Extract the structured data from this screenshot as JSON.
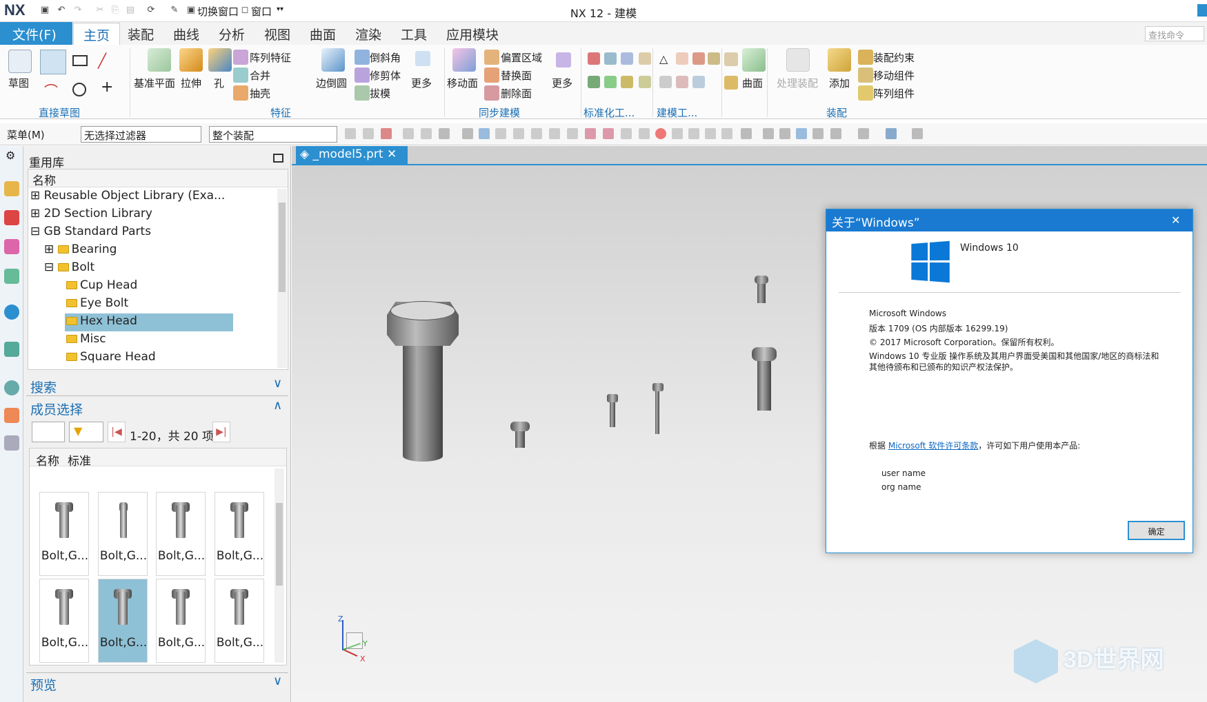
{
  "app": {
    "logo": "NX",
    "title": "NX 12 - 建模"
  },
  "quick_access": {
    "switch_window": "切换窗口",
    "window": "窗口"
  },
  "menu": {
    "file": "文件(F)",
    "tabs": [
      "主页",
      "装配",
      "曲线",
      "分析",
      "视图",
      "曲面",
      "渲染",
      "工具",
      "应用模块"
    ],
    "search_placeholder": "查找命令"
  },
  "ribbon": {
    "sketch": "草图",
    "groups": {
      "direct_sketch": "直接草图",
      "feature": "特征",
      "sync": "同步建模",
      "standard": "标准化工...",
      "modeling": "建模工...",
      "assembly": "装配"
    },
    "feature": {
      "datum_plane": "基准平面",
      "extrude": "拉伸",
      "hole": "孔",
      "pattern": "阵列特征",
      "unite": "合并",
      "shell": "抽壳",
      "edge_blend": "边倒圆",
      "chamfer": "倒斜角",
      "trim_body": "修剪体",
      "draft": "拔模",
      "more": "更多"
    },
    "sync": {
      "move_face": "移动面",
      "offset_region": "偏置区域",
      "replace_face": "替换面",
      "delete_face": "删除面",
      "more": "更多"
    },
    "surface": "曲面",
    "assembly": {
      "process": "处理装配",
      "add": "添加",
      "constraint": "装配约束",
      "move_component": "移动组件",
      "pattern_component": "阵列组件"
    }
  },
  "toolbar2": {
    "menu": "菜单(M)",
    "filter": "无选择过滤器",
    "scope": "整个装配"
  },
  "navigator": {
    "title": "重用库",
    "column_name": "名称",
    "tree": [
      {
        "label": "Reusable Object Library (Exa..."
      },
      {
        "label": "2D Section Library"
      },
      {
        "label": "GB Standard Parts"
      },
      {
        "label": "Bearing"
      },
      {
        "label": "Bolt"
      },
      {
        "label": "Cup Head"
      },
      {
        "label": "Eye Bolt"
      },
      {
        "label": "Hex Head"
      },
      {
        "label": "Misc"
      },
      {
        "label": "Square Head"
      }
    ],
    "search": "搜索",
    "member_select": "成员选择",
    "pager": "1-20，共 20 项",
    "col_name": "名称",
    "col_std": "标准",
    "thumbs": [
      "Bolt,G...",
      "Bolt,G...",
      "Bolt,G...",
      "Bolt,G...",
      "Bolt,G...",
      "Bolt,G...",
      "Bolt,G...",
      "Bolt,G..."
    ],
    "preview": "预览"
  },
  "doc_tab": "_model5.prt",
  "dialog": {
    "title": "关于“Windows”",
    "brand": "Windows 10",
    "product": "Microsoft Windows",
    "version": "版本 1709 (OS 内部版本 16299.19)",
    "copyright": "© 2017 Microsoft Corporation。保留所有权利。",
    "legal1": "Windows 10 专业版 操作系统及其用户界面受美国和其他国家/地区的商标法和",
    "legal2": "其他待颁布和已颁布的知识产权法保护。",
    "license_pre": "根据",
    "license_link": "Microsoft 软件许可条款",
    "license_post": "，许可如下用户使用本产品:",
    "user": "user name",
    "org": "org name",
    "ok": "确定"
  },
  "axes": {
    "z": "Z",
    "y": "Y",
    "x": "X"
  },
  "watermark": "3D世界网"
}
